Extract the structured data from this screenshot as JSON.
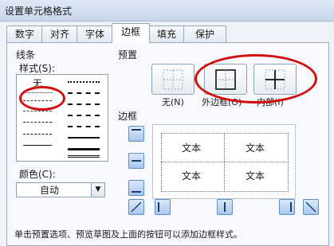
{
  "window": {
    "title": "设置单元格格式"
  },
  "tabs": [
    "数字",
    "对齐",
    "字体",
    "边框",
    "填充",
    "保护"
  ],
  "line": {
    "section_title": "线条",
    "style_label": "样式(S):",
    "none_label": "无"
  },
  "color": {
    "label": "颜色(C):",
    "value": "自动"
  },
  "presets": {
    "section_title": "预置",
    "none": "无(N)",
    "outline": "外边框(O)",
    "inside": "内部(I)"
  },
  "border": {
    "section_title": "边框",
    "cells": [
      "文本",
      "文本",
      "文本",
      "文本"
    ]
  },
  "hint": "单击预置选项、预览草图及上面的按钮可以添加边框样式。"
}
